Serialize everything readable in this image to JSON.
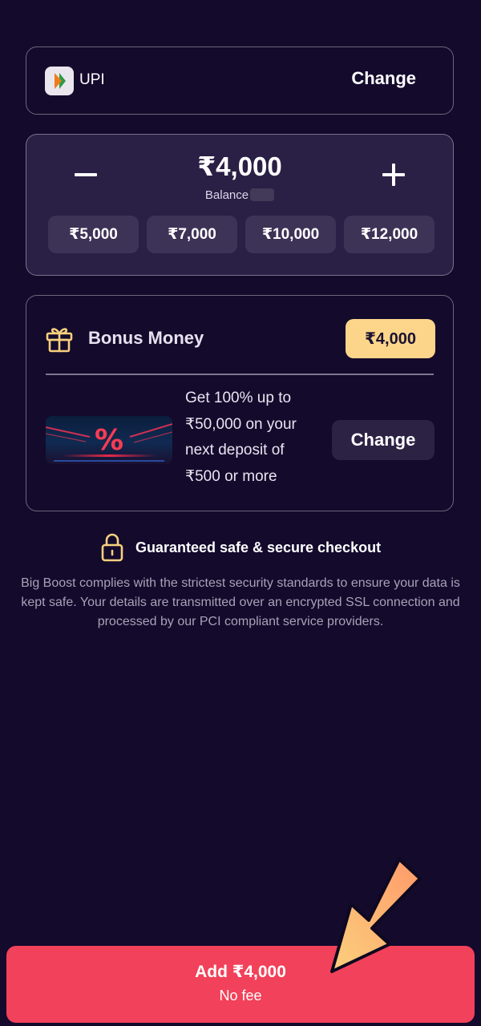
{
  "payment_method": {
    "label": "UPI",
    "icon": "upi-logo-icon",
    "change_label": "Change"
  },
  "amount": {
    "value": "₹4,000",
    "balance_label": "Balance",
    "minus_icon": "minus-icon",
    "plus_icon": "plus-icon",
    "presets": [
      "₹5,000",
      "₹7,000",
      "₹10,000",
      "₹12,000"
    ]
  },
  "bonus": {
    "icon": "gift-icon",
    "title": "Bonus Money",
    "amount": "₹4,000",
    "promo_image": "percent-promo-banner",
    "promo_lines": [
      "Get 100% up to",
      "₹50,000 on your",
      "next deposit of",
      "₹500 or more"
    ],
    "change_label": "Change"
  },
  "security": {
    "icon": "lock-icon",
    "title": "Guaranteed safe & secure checkout",
    "description": "Big Boost complies with the strictest security standards to ensure your data is kept safe. Your details are transmitted over an encrypted SSL connection and processed by our PCI compliant service providers."
  },
  "cta": {
    "label": "Add ₹4,000",
    "sublabel": "No fee"
  },
  "colors": {
    "background": "#130a2c",
    "accent": "#f2415a",
    "bonus_badge": "#fdd58a",
    "icon_gold": "#f8cf7e"
  }
}
